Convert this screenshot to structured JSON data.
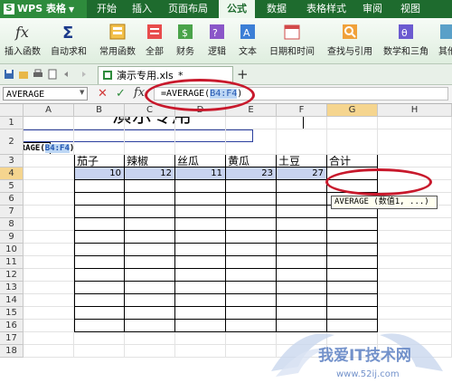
{
  "app": {
    "logo": "WPS 表格",
    "logo_letter": "S"
  },
  "menu_tabs": [
    "开始",
    "插入",
    "页面布局",
    "公式",
    "数据",
    "表格样式",
    "审阅",
    "视图"
  ],
  "ribbon": [
    "插入函数",
    "自动求和",
    "常用函数",
    "全部",
    "财务",
    "逻辑",
    "文本",
    "日期和时间",
    "查找与引用",
    "数学和三角",
    "其他"
  ],
  "doc_tab": {
    "name": "演示专用.xls",
    "marker": "*"
  },
  "formula_bar": {
    "name_box": "AVERAGE",
    "prefix": "=AVERAGE(",
    "ref": "B4:F4",
    "suffix": ")",
    "fx": "fx"
  },
  "columns": [
    "A",
    "B",
    "C",
    "D",
    "E",
    "F",
    "G",
    "H"
  ],
  "rows": [
    "1",
    "2",
    "3",
    "4",
    "5",
    "6",
    "7",
    "8",
    "9",
    "10",
    "11",
    "12",
    "13",
    "14",
    "15",
    "16",
    "17",
    "18"
  ],
  "sheet": {
    "title": "演示专用",
    "headers": [
      "茄子",
      "辣椒",
      "丝瓜",
      "黄瓜",
      "土豆",
      "合计"
    ],
    "values": [
      "10",
      "12",
      "11",
      "23",
      "27"
    ],
    "edit_cell": {
      "prefix": "=AVERAGE(",
      "ref": "B4:F4",
      "suffix": ")"
    }
  },
  "tooltip": "AVERAGE (数值1, ...)",
  "watermark": {
    "text": "我爱IT技术网",
    "url": "www.52ij.com"
  },
  "colors": {
    "title_bar": "#1e6b2e",
    "annotation": "#c8192c",
    "selection": "#c8d3f0"
  }
}
